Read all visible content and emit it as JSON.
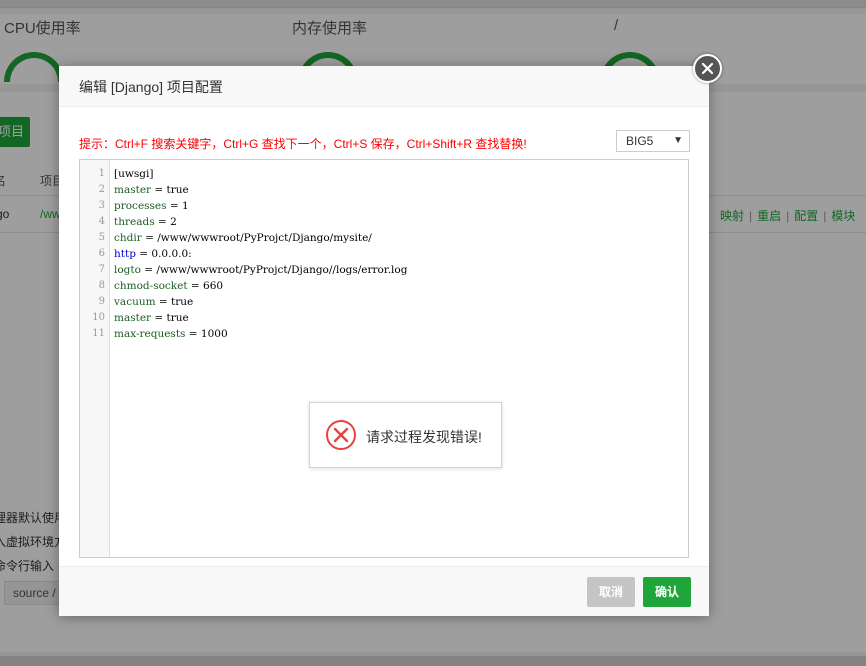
{
  "background": {
    "stats": {
      "cpu_label": "CPU使用率",
      "memory_label": "内存使用率",
      "disk_label": "/"
    },
    "add_button_label": "项目",
    "table": {
      "headers": [
        "名",
        "项目"
      ],
      "row": {
        "name": "go",
        "path": "/ww",
        "actions": [
          "映射",
          "重启",
          "配置",
          "模块"
        ]
      }
    },
    "notes": [
      "理器默认使用",
      "入虚拟环境方",
      "命令行输入"
    ],
    "command_input_value": "source /"
  },
  "dialog": {
    "title": "编辑 [Django] 项目配置",
    "hint": "提示：Ctrl+F 搜索关键字，Ctrl+G 查找下一个，Ctrl+S 保存，Ctrl+Shift+R 查找替换!",
    "encoding": "BIG5",
    "code_lines": [
      "[uwsgi]",
      "master = true",
      "processes = 1",
      "threads = 2",
      "chdir = /www/wwwroot/PyProjct/Django/mysite/",
      "http = 0.0.0.0:",
      "logto = /www/wwwroot/PyProjct/Django//logs/error.log",
      "chmod-socket = 660",
      "vacuum = true",
      "master = true",
      "max-requests = 1000"
    ],
    "error_toast": "请求过程发现错误!",
    "cancel_label": "取消",
    "confirm_label": "确认"
  },
  "colors": {
    "accent": "#20a53a",
    "hint_red": "#ff0000",
    "error_red": "#e64340"
  },
  "icons": {
    "close": "close-icon",
    "error": "error-circle-icon",
    "dropdown": "caret-down-icon"
  }
}
